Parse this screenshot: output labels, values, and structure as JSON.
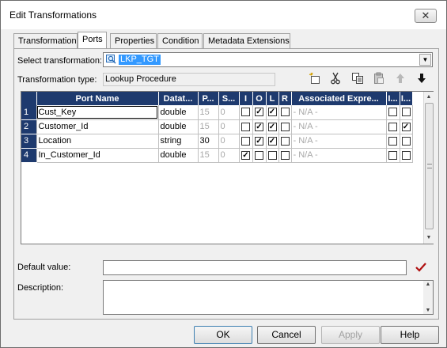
{
  "window": {
    "title": "Edit Transformations",
    "close_glyph": "✕"
  },
  "tabs": [
    {
      "label": "Transformation"
    },
    {
      "label": "Ports"
    },
    {
      "label": "Properties"
    },
    {
      "label": "Condition"
    },
    {
      "label": "Metadata Extensions"
    }
  ],
  "active_tab": "Ports",
  "select_transformation": {
    "label": "Select transformation:",
    "value": "LKP_TGT",
    "icon": "lookup-icon"
  },
  "transformation_type": {
    "label": "Transformation type:",
    "value": "Lookup Procedure"
  },
  "toolbar_icons": [
    "new-port-icon",
    "cut-icon",
    "copy-icon",
    "paste-icon",
    "move-up-icon",
    "move-down-icon"
  ],
  "grid": {
    "columns": [
      "Port Name",
      "Datat...",
      "P...",
      "S...",
      "I",
      "O",
      "L",
      "R",
      "Associated Expre...",
      "I...",
      "I..."
    ],
    "rows": [
      {
        "num": "1",
        "name": "Cust_Key",
        "datatype": "double",
        "precision": "15",
        "scale": "0",
        "I": false,
        "O": true,
        "L": true,
        "R": false,
        "assoc": "- N/A -",
        "i1": false,
        "i2": false
      },
      {
        "num": "2",
        "name": "Customer_Id",
        "datatype": "double",
        "precision": "15",
        "scale": "0",
        "I": false,
        "O": true,
        "L": true,
        "R": false,
        "assoc": "- N/A -",
        "i1": false,
        "i2": true
      },
      {
        "num": "3",
        "name": "Location",
        "datatype": "string",
        "precision": "30",
        "scale": "0",
        "I": false,
        "O": true,
        "L": true,
        "R": false,
        "assoc": "- N/A -",
        "i1": false,
        "i2": false
      },
      {
        "num": "4",
        "name": "In_Customer_Id",
        "datatype": "double",
        "precision": "15",
        "scale": "0",
        "I": true,
        "O": false,
        "L": false,
        "R": false,
        "assoc": "- N/A -",
        "i1": false,
        "i2": false
      }
    ]
  },
  "default_value": {
    "label": "Default value:",
    "value": ""
  },
  "description": {
    "label": "Description:",
    "value": ""
  },
  "buttons": {
    "ok": "OK",
    "cancel": "Cancel",
    "apply": "Apply",
    "help": "Help"
  },
  "colors": {
    "header_bg": "#1e3a6e",
    "selection": "#3399ff",
    "validate_check": "#b01010"
  }
}
